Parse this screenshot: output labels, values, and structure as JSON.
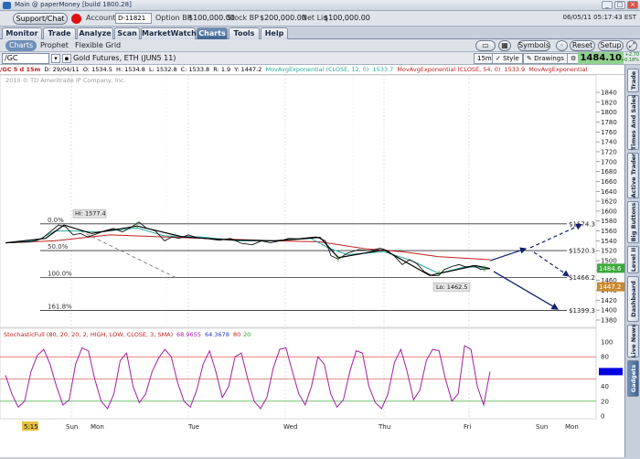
{
  "window": {
    "title": "Main @ paperMoney [build 1800.28]"
  },
  "account": {
    "support_label": "Support/Chat",
    "account_label": "Account",
    "account_id": "D-11821",
    "option_bp_label": "Option BP",
    "option_bp_value": "$100,000.00",
    "stock_bp_label": "Stock BP",
    "stock_bp_value": "$200,000.00",
    "net_liq_label": "Net Liq",
    "net_liq_value": "$100,000.00",
    "datetime": "06/05/11 05:17:43 EST"
  },
  "main_tabs": [
    "Monitor",
    "Trade",
    "Analyze",
    "Scan",
    "MarketWatch",
    "Charts",
    "Tools",
    "Help"
  ],
  "main_tab_active": "Charts",
  "sub_tabs": [
    "Charts",
    "Prophet",
    "Flexible Grid"
  ],
  "toolbar": {
    "symbols_label": "Symbols",
    "reset_label": "Reset",
    "setup_label": "Setup"
  },
  "chart_controls": {
    "symbol": "/GC",
    "symbol_name": "Gold Futures, ETH (JUN5 11)",
    "interval": "15m",
    "style_label": "Style",
    "drawings_label": "Drawings",
    "last_price": "1484.10",
    "change": "+2.70",
    "change_pct": "+0.18%"
  },
  "info_line": {
    "title": "/GC 5 d 15m",
    "date": "D: 29/04/11",
    "open": "O: 1534.5",
    "high": "H: 1534.8",
    "low": "L: 1532.8",
    "close": "C: 1533.8",
    "range": "R: 1.9",
    "y": "Y: 1447.2",
    "ema12_label": "MovAvgExponential (CLOSE, 12, 0)",
    "ema12_value": "1533.7",
    "ema54_label": "MovAvgExponential (CLOSE, 54, 0)",
    "ema54_value": "1533.9",
    "ema_extra": "MovAvgExponential"
  },
  "copyright": "2010 © TD Ameritrade IP Company, Inc.",
  "price_axis": {
    "ticks": [
      "1840",
      "1820",
      "1800",
      "1780",
      "1760",
      "1740",
      "1720",
      "1700",
      "1680",
      "1660",
      "1640",
      "1620",
      "1600",
      "1580",
      "1560",
      "1540",
      "1520",
      "1500",
      "1480",
      "1460",
      "1440",
      "1420",
      "1400",
      "1380"
    ],
    "last_badge": "1484.6",
    "cursor_badge": "1447.2"
  },
  "fib_levels": [
    {
      "pct": "0.0%",
      "price": "$1574.3"
    },
    {
      "pct": "50.0%",
      "price": "$1520.3"
    },
    {
      "pct": "100.0%",
      "price": "$1466.2"
    },
    {
      "pct": "161.8%",
      "price": "$1399.3"
    }
  ],
  "annotations": {
    "high": "Hi: 1577.4",
    "low": "Lo: 1462.5"
  },
  "stochastic": {
    "label": "StochasticFull (80, 20, 20, 2, HIGH, LOW, CLOSE, 3, SMA)",
    "v1": "68.9655",
    "v2": "64.3678",
    "v3": "80",
    "v4": "20",
    "ticks": [
      "100",
      "80",
      "60",
      "40",
      "20",
      "0"
    ]
  },
  "time_axis": {
    "labels": [
      "Sun",
      "Mon",
      "Tue",
      "Wed",
      "Thu",
      "Fri",
      "Sun",
      "Mon"
    ],
    "time_badge": "5:15"
  },
  "sidebar_tabs": [
    "Trade",
    "Times And Sales",
    "Active Trader",
    "Big Buttons",
    "Level II",
    "Dashboard",
    "Live News",
    "Gadgets"
  ],
  "colors": {
    "ema12": "#2aa8a0",
    "ema54": "#c02020",
    "stoch": "#a020a0",
    "arrow": "#12206e",
    "price_line": "#111111",
    "ob_line": "#e03030",
    "os_line": "#20a020"
  }
}
